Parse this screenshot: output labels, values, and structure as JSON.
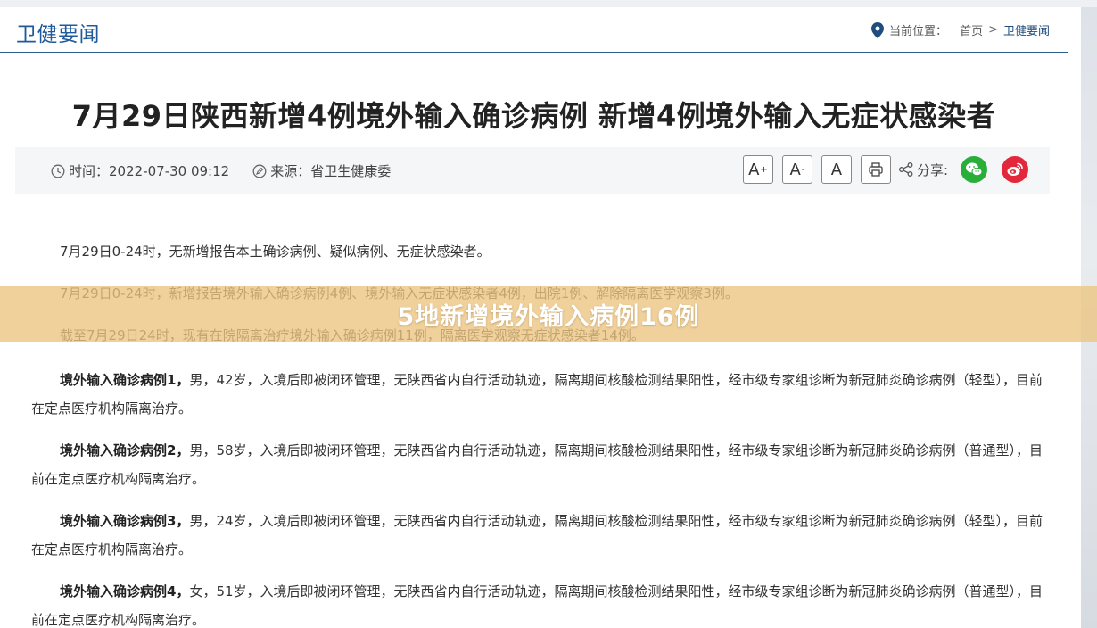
{
  "header": {
    "section_title": "卫健要闻",
    "location_label": "当前位置：",
    "crumbs": [
      "首页",
      "卫健要闻"
    ],
    "crumb_separator": ">"
  },
  "article": {
    "title": "7月29日陕西新增4例境外输入确诊病例 新增4例境外输入无症状感染者",
    "time_label": "时间：",
    "time_value": "2022-07-30 09:12",
    "source_label": "来源：",
    "source_value": "省卫生健康委",
    "font_increase": "A",
    "font_decrease": "A",
    "font_reset": "A",
    "share_label": "分享:",
    "paragraphs": [
      "7月29日0-24时，无新增报告本土确诊病例、疑似病例、无症状感染者。",
      "7月29日0-24时，新增报告境外输入确诊病例4例、境外输入无症状感染者4例，出院1例、解除隔离医学观察3例。",
      "截至7月29日24时，现有在院隔离治疗境外输入确诊病例11例，隔离医学观察无症状感染者14例。"
    ],
    "cases": [
      {
        "label": "境外输入确诊病例1，",
        "text": "男，42岁，入境后即被闭环管理，无陕西省内自行活动轨迹，隔离期间核酸检测结果阳性，经市级专家组诊断为新冠肺炎确诊病例（轻型），目前在定点医疗机构隔离治疗。"
      },
      {
        "label": "境外输入确诊病例2，",
        "text": "男，58岁，入境后即被闭环管理，无陕西省内自行活动轨迹，隔离期间核酸检测结果阳性，经市级专家组诊断为新冠肺炎确诊病例（普通型），目前在定点医疗机构隔离治疗。"
      },
      {
        "label": "境外输入确诊病例3，",
        "text": "男，24岁，入境后即被闭环管理，无陕西省内自行活动轨迹，隔离期间核酸检测结果阳性，经市级专家组诊断为新冠肺炎确诊病例（轻型），目前在定点医疗机构隔离治疗。"
      },
      {
        "label": "境外输入确诊病例4，",
        "text": "女，51岁，入境后即被闭环管理，无陕西省内自行活动轨迹，隔离期间核酸检测结果阳性，经市级专家组诊断为新冠肺炎确诊病例（普通型），目前在定点医疗机构隔离治疗。"
      }
    ]
  },
  "banner": {
    "text": "5地新增境外输入病例16例"
  },
  "colors": {
    "accent": "#1f5a9a",
    "wechat": "#2aae3a",
    "weibo": "#e2283a",
    "banner": "#ecc480"
  },
  "icons": [
    "location-pin-icon",
    "clock-icon",
    "edit-icon",
    "print-icon",
    "share-icon",
    "wechat-icon",
    "weibo-icon"
  ]
}
